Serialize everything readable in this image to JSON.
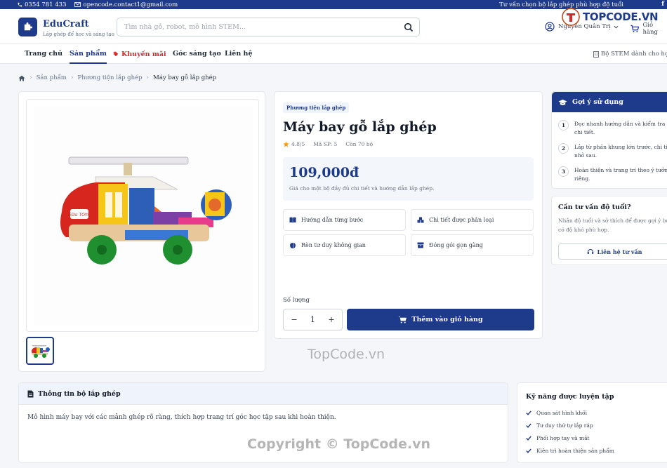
{
  "topbar": {
    "phone": "0354 781 433",
    "email": "opencode.contact1@gmail.com",
    "right_text": "Tư vấn chọn bộ lắp ghép phù hợp độ tuổi",
    "social": "f"
  },
  "header": {
    "brand": "EduCraft",
    "tagline": "Lắp ghép để học và sáng tạo",
    "search_placeholder": "Tìm nhà gỗ, robot, mô hình STEM...",
    "user_name": "Nguyễn Quân Trị",
    "cart_label": "Giỏ hàng",
    "overlay_logo": "TOPCODE.VN"
  },
  "nav": {
    "items": [
      {
        "label": "Trang chủ"
      },
      {
        "label": "Sản phẩm"
      },
      {
        "label": "Khuyến mãi"
      },
      {
        "label": "Góc sáng tạo"
      },
      {
        "label": "Liên hệ"
      }
    ],
    "right_text": "Bộ STEM dành cho học sinh"
  },
  "breadcrumb": {
    "items": [
      "Sản phẩm",
      "Phương tiện lắp ghép",
      "Máy bay gỗ lắp ghép"
    ]
  },
  "product": {
    "category_badge": "Phương tiện lắp ghép",
    "title": "Máy bay gỗ lắp ghép",
    "rating": "4.8/5",
    "sku": "Mã SP: 5",
    "stock": "Còn 70 bộ",
    "price": "109,000đ",
    "price_note": "Giá cho một bộ đầy đủ chi tiết và hướng dẫn lắp ghép.",
    "features": [
      "Hướng dẫn từng bước",
      "Chi tiết được phân loại",
      "Rèn tư duy không gian",
      "Đóng gói gọn gàng"
    ],
    "qty_label": "Số lượng",
    "qty_value": "1",
    "add_to_cart": "Thêm vào giỏ hàng"
  },
  "guide": {
    "title": "Gợi ý sử dụng",
    "steps": [
      {
        "num": "1",
        "text": "Đọc nhanh hướng dẫn và kiểm tra đủ chi tiết."
      },
      {
        "num": "2",
        "text": "Lắp từ phần khung lớn trước, chi tiết nhỏ sau."
      },
      {
        "num": "3",
        "text": "Hoàn thiện và trang trí theo ý tưởng riêng."
      }
    ]
  },
  "advice": {
    "title": "Cần tư vấn độ tuổi?",
    "desc": "Nhắn độ tuổi và sở thích để được gợi ý bộ có độ khó phù hợp.",
    "button": "Liên hệ tư vấn"
  },
  "description": {
    "title": "Thông tin bộ lắp ghép",
    "text": "Mô hình máy bay với các mảnh ghép rõ ràng, thích hợp trang trí góc học tập sau khi hoàn thiện."
  },
  "skills": {
    "title": "Kỹ năng được luyện tập",
    "items": [
      "Quan sát hình khối",
      "Tư duy thứ tự lắp ráp",
      "Phối hợp tay và mắt",
      "Kiên trì hoàn thiện sản phẩm"
    ]
  },
  "watermarks": {
    "center": "TopCode.vn",
    "copyright": "Copyright © TopCode.vn"
  },
  "colors": {
    "primary": "#1e3a8a",
    "promo": "#dc2626",
    "star": "#f59e0b"
  }
}
